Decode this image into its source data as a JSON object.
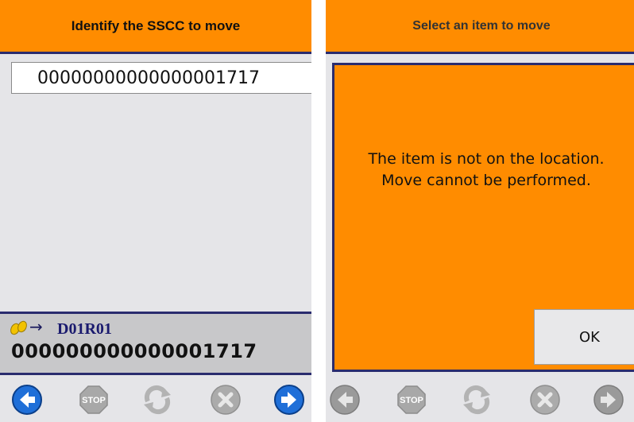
{
  "left_screen": {
    "title": "Identify the SSCC to move",
    "sscc_input_value": "00000000000000001717",
    "scan_location": "D01R01",
    "scanned_sscc": "000000000000001717",
    "toolbar": [
      "back-arrow-icon",
      "stop-icon",
      "refresh-icon",
      "cancel-icon",
      "forward-arrow-icon"
    ]
  },
  "right_screen": {
    "title": "Select an item to move",
    "dialog_message": "The item is not on the location. Move cannot be performed.",
    "ok_label": "OK",
    "toolbar": [
      "back-arrow-icon",
      "stop-icon",
      "refresh-icon",
      "cancel-icon",
      "forward-arrow-icon"
    ]
  },
  "colors": {
    "header_orange": "#ff8c00",
    "border_navy": "#2a2c6e",
    "panel_gray": "#e5e5e8",
    "nav_blue": "#1f6fd8",
    "disabled_gray": "#9a9a9a"
  },
  "stop_label": "STOP"
}
